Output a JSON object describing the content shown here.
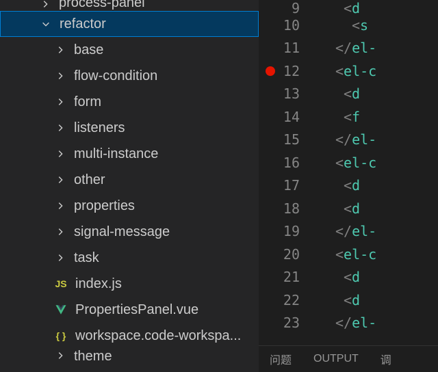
{
  "sidebar": {
    "top_cut": {
      "label": "process-panel"
    },
    "selected": {
      "label": "refactor"
    },
    "children": [
      {
        "label": "base"
      },
      {
        "label": "flow-condition"
      },
      {
        "label": "form"
      },
      {
        "label": "listeners"
      },
      {
        "label": "multi-instance"
      },
      {
        "label": "other"
      },
      {
        "label": "properties"
      },
      {
        "label": "signal-message"
      },
      {
        "label": "task"
      }
    ],
    "files": [
      {
        "label": "index.js",
        "icon": "JS",
        "cls": "js"
      },
      {
        "label": "PropertiesPanel.vue",
        "icon": "V",
        "cls": "vue"
      },
      {
        "label": "workspace.code-workspa...",
        "icon": "{ }",
        "cls": "json"
      }
    ],
    "bottom_cut": {
      "label": "theme"
    }
  },
  "gutter": {
    "start": 9,
    "end": 23,
    "breakpoint_at": 12
  },
  "code": [
    {
      "indent": 7,
      "open": true,
      "close": false,
      "tag": "d",
      "attr": ""
    },
    {
      "indent": 8,
      "open": true,
      "close": false,
      "tag": "s",
      "attr": ""
    },
    {
      "indent": 6,
      "open": false,
      "close": true,
      "tag": "el-",
      "attr": ""
    },
    {
      "indent": 6,
      "open": true,
      "close": false,
      "tag": "el-c",
      "attr": ""
    },
    {
      "indent": 7,
      "open": true,
      "close": false,
      "tag": "d",
      "attr": ""
    },
    {
      "indent": 7,
      "open": true,
      "close": false,
      "tag": "f",
      "attr": ""
    },
    {
      "indent": 6,
      "open": false,
      "close": true,
      "tag": "el-",
      "attr": ""
    },
    {
      "indent": 6,
      "open": true,
      "close": false,
      "tag": "el-c",
      "attr": ""
    },
    {
      "indent": 7,
      "open": true,
      "close": false,
      "tag": "d",
      "attr": ""
    },
    {
      "indent": 7,
      "open": true,
      "close": false,
      "tag": "d",
      "attr": ""
    },
    {
      "indent": 6,
      "open": false,
      "close": true,
      "tag": "el-",
      "attr": ""
    },
    {
      "indent": 6,
      "open": true,
      "close": false,
      "tag": "el-c",
      "attr": ""
    },
    {
      "indent": 7,
      "open": true,
      "close": false,
      "tag": "d",
      "attr": ""
    },
    {
      "indent": 7,
      "open": true,
      "close": false,
      "tag": "d",
      "attr": ""
    },
    {
      "indent": 6,
      "open": false,
      "close": true,
      "tag": "el-",
      "attr": ""
    }
  ],
  "panel": {
    "tabs": [
      "问题",
      "OUTPUT",
      "调"
    ]
  }
}
